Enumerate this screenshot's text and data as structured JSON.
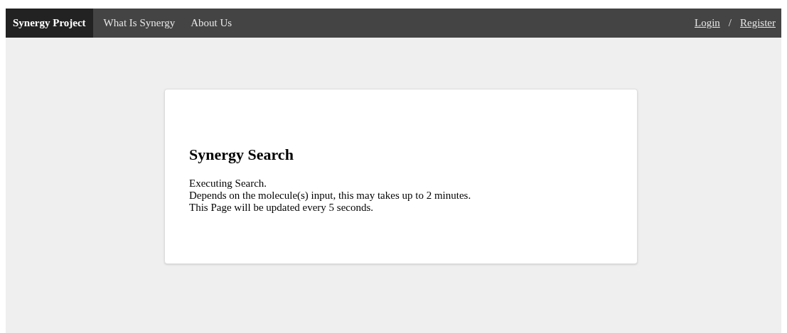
{
  "navbar": {
    "brand": "Synergy Project",
    "links": [
      {
        "label": "What Is Synergy"
      },
      {
        "label": "About Us"
      }
    ],
    "auth": {
      "login": "Login",
      "separator": "/",
      "register": "Register"
    }
  },
  "card": {
    "title": "Synergy Search",
    "lines": [
      "Executing Search.",
      "Depends on the molecule(s) input, this may takes up to 2 minutes.",
      "This Page will be updated every 5 seconds."
    ]
  }
}
